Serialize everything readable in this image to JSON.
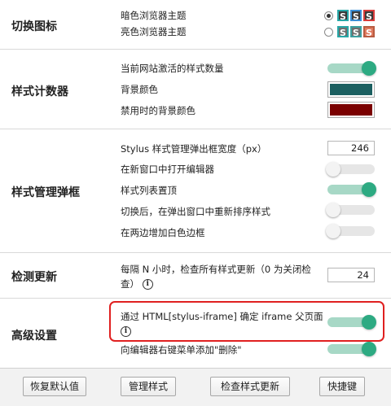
{
  "sections": {
    "toggle_icon": {
      "title": "切换图标",
      "dark_label": "暗色浏览器主题",
      "light_label": "亮色浏览器主题",
      "icon_letter": "S"
    },
    "badge": {
      "title": "样式计数器",
      "count_label": "当前网站激活的样式数量",
      "bg_label": "背景颜色",
      "disabled_bg_label": "禁用时的背景颜色",
      "bg_color": "#1b5f60",
      "disabled_bg_color": "#7a0000"
    },
    "popup": {
      "title": "样式管理弹框",
      "width_label": "Stylus 样式管理弹出框宽度（px）",
      "width_value": "246",
      "new_window_label": "在新窗口中打开编辑器",
      "list_top_label": "样式列表置顶",
      "reorder_label": "切换后，在弹出窗口中重新排序样式",
      "white_border_label": "在两边增加白色边框"
    },
    "updates": {
      "title": "检测更新",
      "interval_label": "每隔 N 小时，检查所有样式更新（0 为关闭检查）",
      "interval_value": "24"
    },
    "advanced": {
      "title": "高级设置",
      "iframe_label": "通过 HTML[stylus-iframe] 确定 iframe 父页面",
      "context_menu_label": "向编辑器右键菜单添加\"删除\""
    }
  },
  "info_glyph": "i",
  "footer": {
    "reset": "恢复默认值",
    "manage": "管理样式",
    "check": "检查样式更新",
    "shortcuts": "快捷键"
  },
  "colors": {
    "accent": "#2daa82",
    "highlight": "#e02020"
  }
}
